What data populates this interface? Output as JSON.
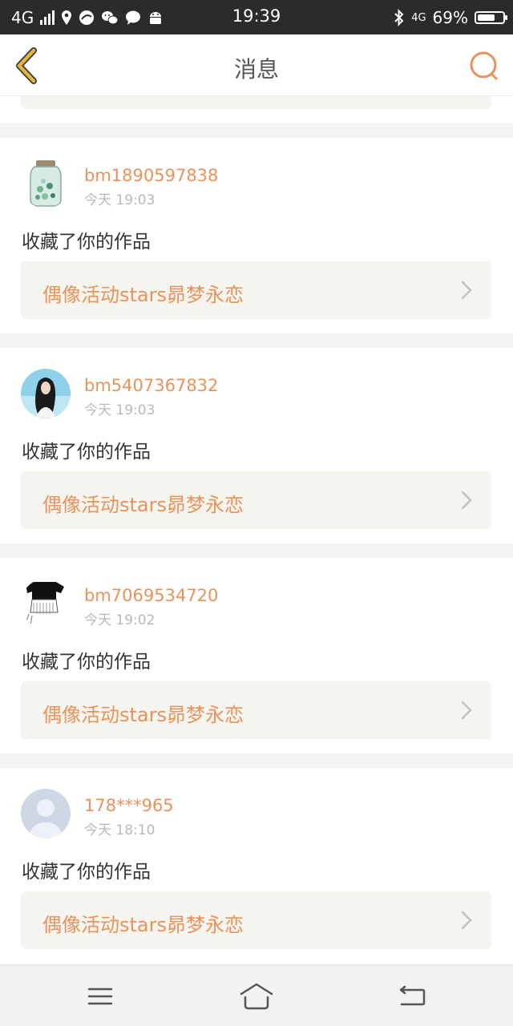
{
  "status_bar": {
    "network": "4G",
    "time": "19:39",
    "network_right": "4G",
    "battery_text": "69%",
    "battery_level": 0.69,
    "icons_left": [
      "signal-bars-icon",
      "location-icon",
      "app-icon",
      "wechat-icon",
      "message-icon",
      "android-icon"
    ],
    "icons_right": [
      "bluetooth-icon",
      "4g-icon",
      "battery-icon"
    ]
  },
  "header": {
    "title": "消息",
    "back_icon": "chevron-left-icon",
    "search_icon": "search-icon",
    "accent_color": "#e8935c",
    "back_color": "#e2b63c"
  },
  "notifications": [
    {
      "username": "bm1890597838",
      "time": "今天 19:03",
      "action": "收藏了你的作品",
      "work_title": "偶像活动stars昴梦永恋",
      "avatar": "jar-avatar"
    },
    {
      "username": "bm5407367832",
      "time": "今天 19:03",
      "action": "收藏了你的作品",
      "work_title": "偶像活动stars昴梦永恋",
      "avatar": "girl-avatar"
    },
    {
      "username": "bm7069534720",
      "time": "今天 19:02",
      "action": "收藏了你的作品",
      "work_title": "偶像活动stars昴梦永恋",
      "avatar": "sketch-avatar"
    },
    {
      "username": "178***965",
      "time": "今天 18:10",
      "action": "收藏了你的作品",
      "work_title": "偶像活动stars昴梦永恋",
      "avatar": "default-avatar"
    }
  ],
  "nav_bar": {
    "icons": [
      "menu-icon",
      "home-icon",
      "back-icon"
    ]
  }
}
